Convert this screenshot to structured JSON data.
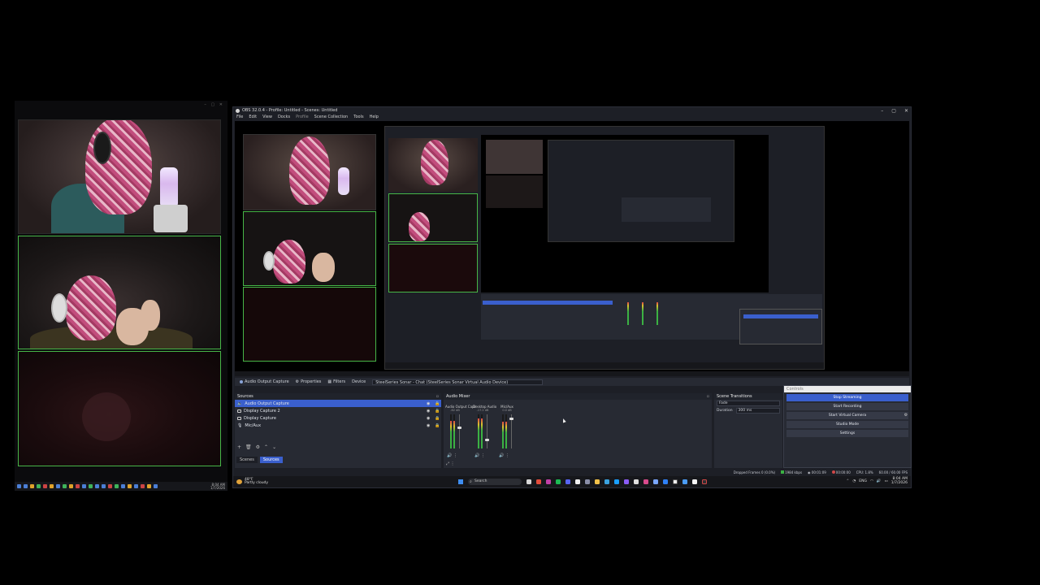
{
  "obs": {
    "title": "OBS 32.0.4 - Profile: Untitled - Scenes: Untitled",
    "menu": [
      "File",
      "Edit",
      "View",
      "Docks",
      "Profile",
      "Scene Collection",
      "Tools",
      "Help"
    ],
    "scene_bar": {
      "source_name": "Audio Output Capture",
      "properties": "Properties",
      "filters": "Filters",
      "device_label": "Device",
      "device_value": "SteelSeries Sonar - Chat (SteelSeries Sonar Virtual Audio Device)"
    },
    "sources": {
      "title": "Sources",
      "items": [
        {
          "name": "Audio Output Capture",
          "selected": true
        },
        {
          "name": "Display Capture 2",
          "selected": false
        },
        {
          "name": "Display Capture",
          "selected": false
        },
        {
          "name": "Mic/Aux",
          "selected": false
        }
      ],
      "tabs": [
        "Scenes",
        "Sources"
      ]
    },
    "mixer": {
      "title": "Audio Mixer",
      "channels": [
        {
          "name": "Audio Output Capt",
          "db": "-62 dB",
          "level": 0.82,
          "fader": 0.35
        },
        {
          "name": "Desktop Audio",
          "db": "-17.2 dB",
          "level": 0.88,
          "fader": 0.72
        },
        {
          "name": "Mic/Aux",
          "db": "0.0 dB",
          "level": 0.78,
          "fader": 0.1
        }
      ]
    },
    "transitions": {
      "title": "Scene Transitions",
      "type": "Fade",
      "duration_label": "Duration",
      "duration_value": "300 ms"
    },
    "controls": {
      "title": "Controls",
      "buttons": [
        "Stop Streaming",
        "Start Recording",
        "Start Virtual Camera",
        "Studio Mode",
        "Settings"
      ]
    },
    "status": {
      "dropped": "Dropped Frames 0 (0.0%)",
      "bitrate": "1984 kbps",
      "stream_time": "00:01:09",
      "rec_time": "00:00:00",
      "cpu": "CPU: 1.8%",
      "fps": "60.00 / 60.00 FPS"
    }
  },
  "taskbar": {
    "weather_temp": "48°F",
    "weather_desc": "Partly cloudy",
    "search": "Search",
    "lang": "ENG",
    "time": "8:04 AM",
    "date": "1/7/2026",
    "left_time": "8:04 AM",
    "left_date": "1/7/2026"
  },
  "colors": {
    "accent": "#3a5fcd",
    "cam_border": "#47b547",
    "dock_bg": "#272a33",
    "window_bg": "#1d1f26"
  }
}
